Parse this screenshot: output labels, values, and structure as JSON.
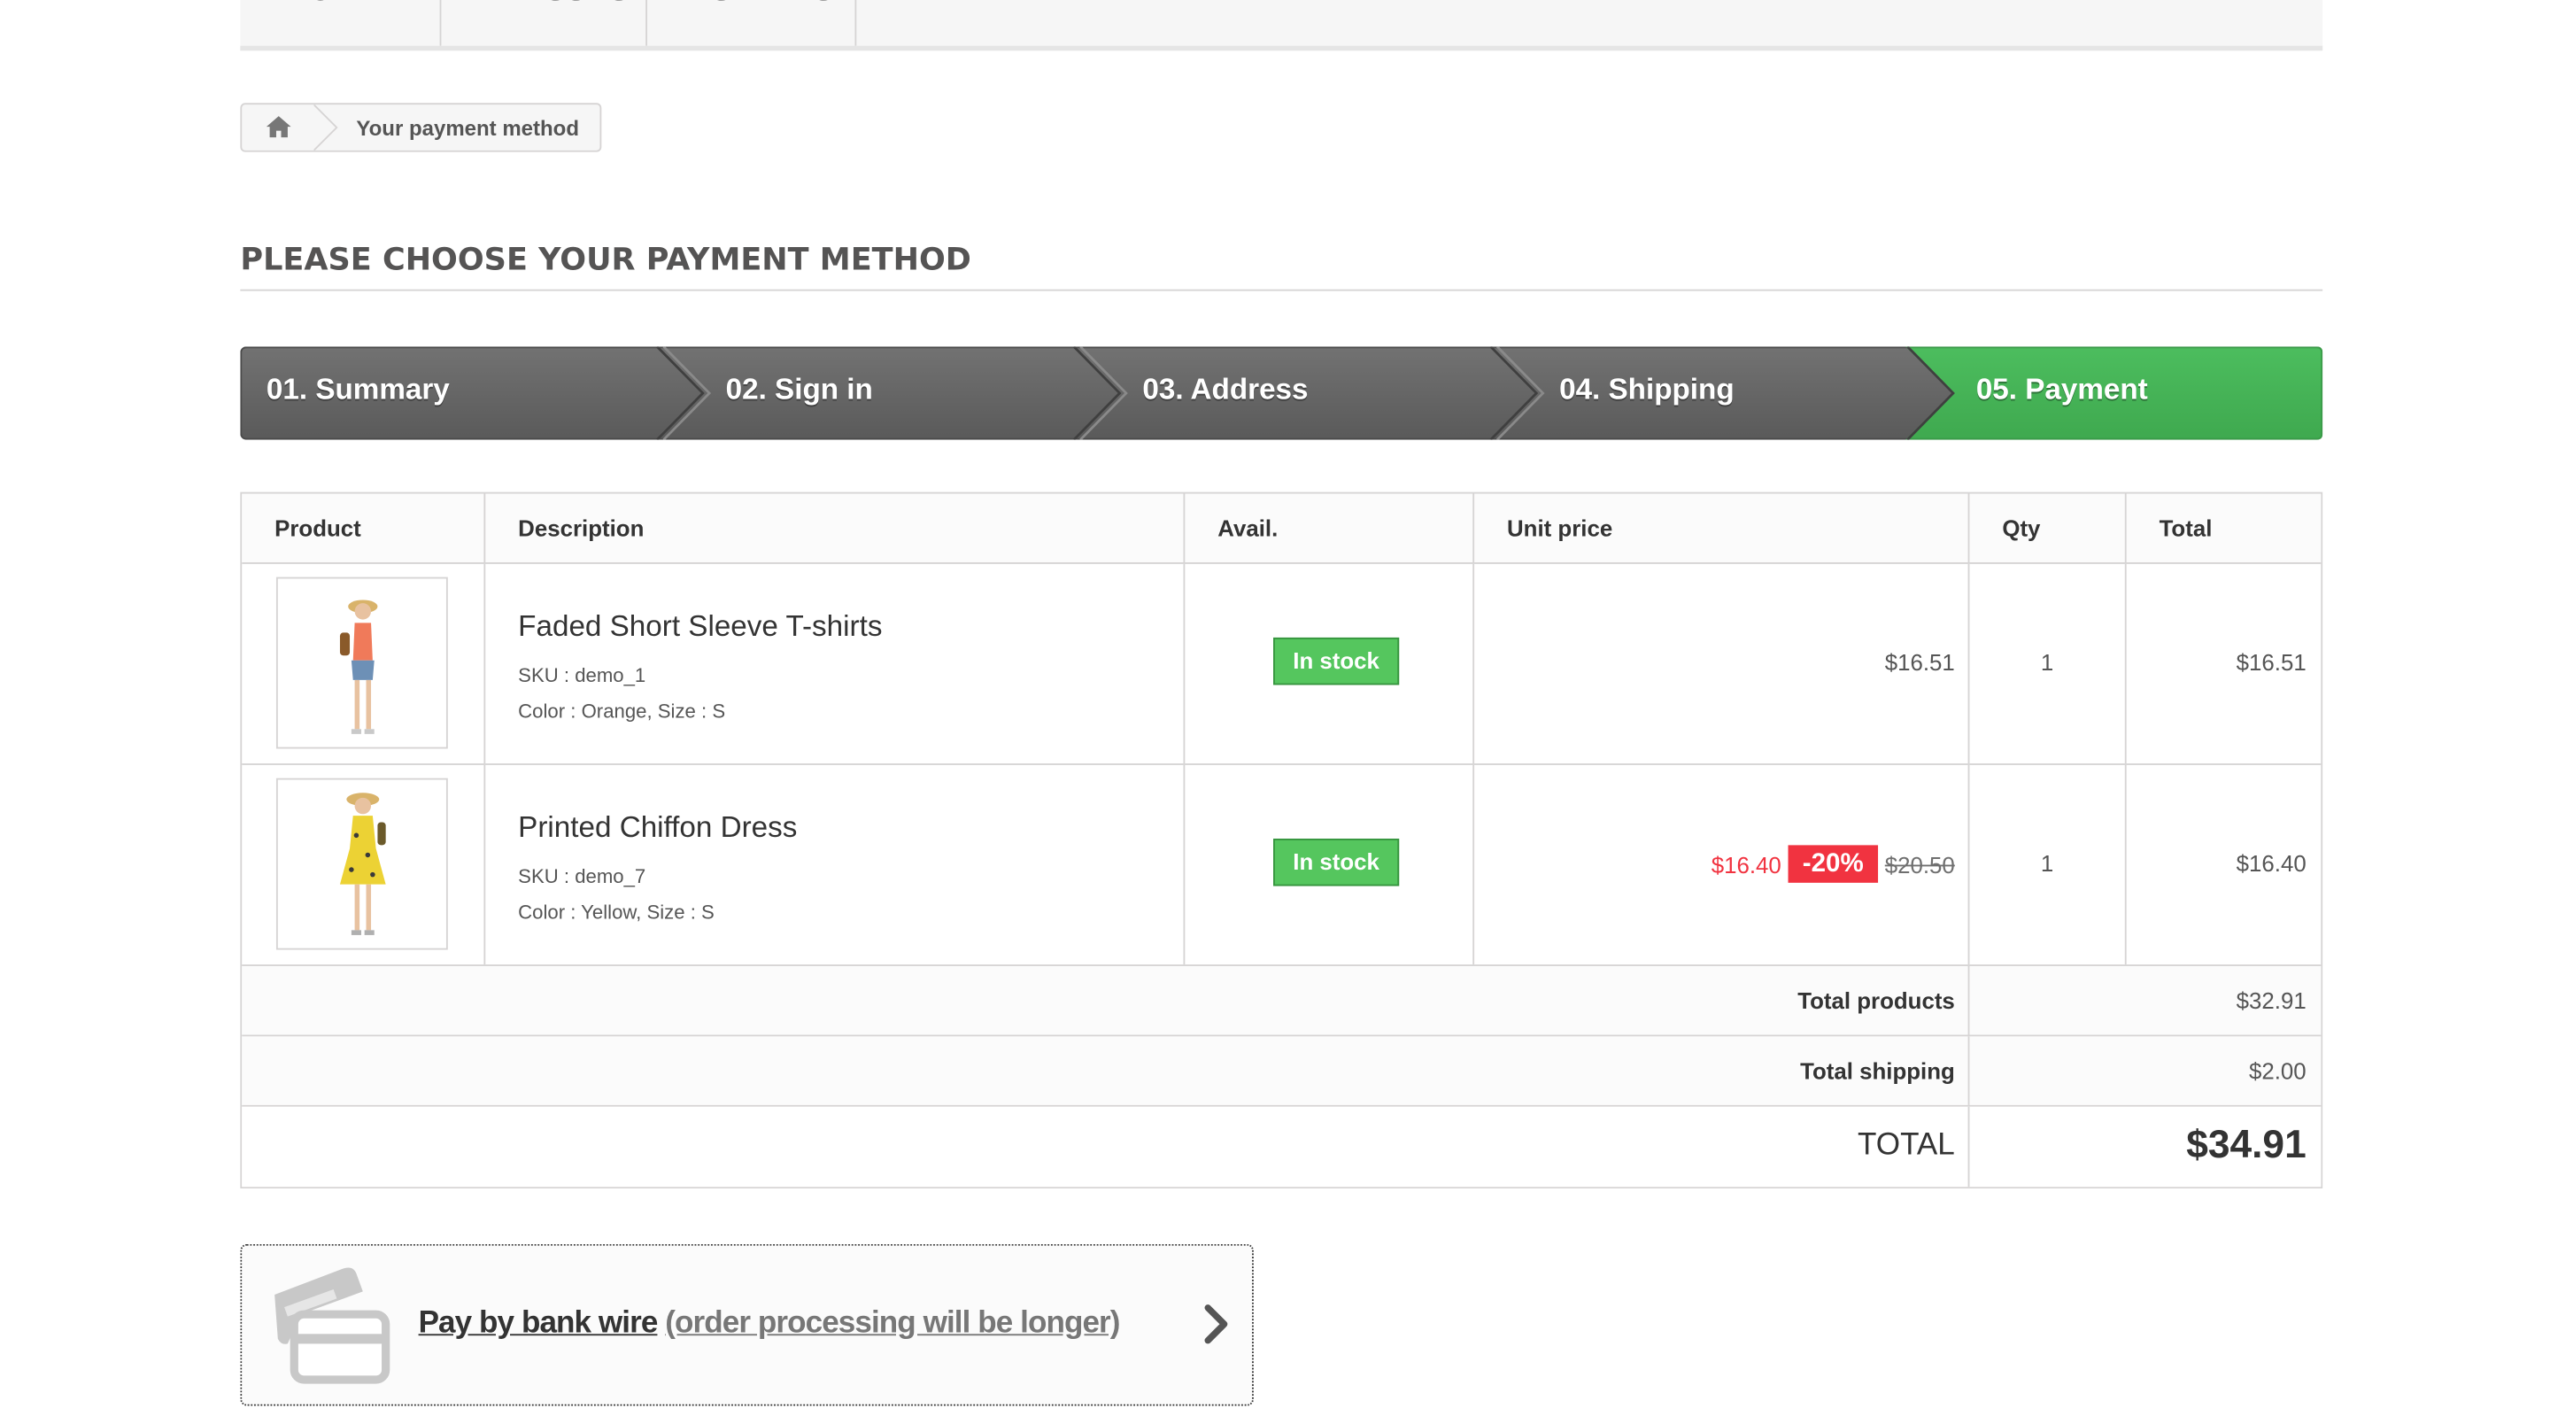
{
  "top_menu": {
    "items": [
      "WOMEN",
      "DRESSES",
      "T-SHIRTS"
    ]
  },
  "breadcrumb": {
    "home_icon": "home-icon",
    "current": "Your payment method"
  },
  "page": {
    "heading": "PLEASE CHOOSE YOUR PAYMENT METHOD"
  },
  "steps": {
    "items": [
      {
        "label": "01. Summary",
        "active": false
      },
      {
        "label": "02. Sign in",
        "active": false
      },
      {
        "label": "03. Address",
        "active": false
      },
      {
        "label": "04. Shipping",
        "active": false
      },
      {
        "label": "05. Payment",
        "active": true
      }
    ],
    "colors": {
      "inactive": "#666666",
      "active": "#46b45a"
    }
  },
  "cart": {
    "headers": {
      "product": "Product",
      "description": "Description",
      "avail": "Avail.",
      "unit_price": "Unit price",
      "qty": "Qty",
      "total": "Total"
    },
    "items": [
      {
        "name": "Faded Short Sleeve T-shirts",
        "sku": "SKU : demo_1",
        "attributes": "Color : Orange, Size : S",
        "availability": "In stock",
        "unit_price": "$16.51",
        "qty": "1",
        "total": "$16.51"
      },
      {
        "name": "Printed Chiffon Dress",
        "sku": "SKU : demo_7",
        "attributes": "Color : Yellow, Size : S",
        "availability": "In stock",
        "price_new": "$16.40",
        "discount": "-20%",
        "price_old": "$20.50",
        "qty": "1",
        "total": "$16.40"
      }
    ],
    "totals": {
      "products_label": "Total products",
      "products_value": "$32.91",
      "shipping_label": "Total shipping",
      "shipping_value": "$2.00",
      "total_label": "TOTAL",
      "total_value": "$34.91"
    },
    "colors": {
      "in_stock": "#55c65e",
      "discount": "#f13340"
    }
  },
  "payment": {
    "icon": "bank-card-icon",
    "label": "Pay by bank wire",
    "note": "(order processing will be longer)",
    "chevron": "chevron-right-icon"
  }
}
